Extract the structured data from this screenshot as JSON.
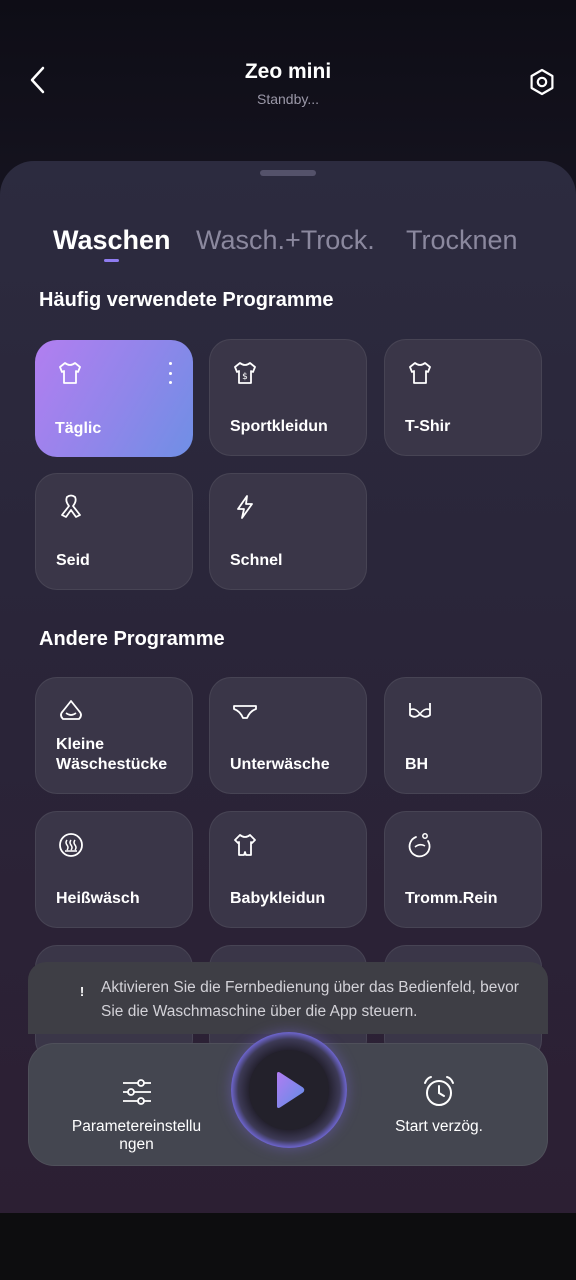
{
  "header": {
    "title": "Zeo mini",
    "subtitle": "Standby...",
    "back_icon": "chevron-left-icon",
    "settings_icon": "gear-icon"
  },
  "tabs": [
    {
      "label": "Waschen",
      "active": true
    },
    {
      "label": "Wasch.+Trock.",
      "active": false
    },
    {
      "label": "Trocknen",
      "active": false
    }
  ],
  "frequent": {
    "title": "Häufig verwendete Programme",
    "items": [
      {
        "label": "Täglic",
        "icon": "shirt-icon",
        "selected": true
      },
      {
        "label": "Sportkleidun",
        "icon": "sport-shirt-icon"
      },
      {
        "label": "T-Shir",
        "icon": "tshirt-icon"
      },
      {
        "label": "Seid",
        "icon": "ribbon-icon"
      },
      {
        "label": "Schnel",
        "icon": "lightning-icon"
      }
    ]
  },
  "other": {
    "title": "Andere Programme",
    "items": [
      {
        "label": "Kleine Wäschestücke",
        "icon": "small-items-icon"
      },
      {
        "label": "Unterwäsche",
        "icon": "underwear-icon"
      },
      {
        "label": "BH",
        "icon": "bra-icon"
      },
      {
        "label": "Heißwäsch",
        "icon": "hot-wash-icon"
      },
      {
        "label": "Babykleidun",
        "icon": "baby-clothes-icon"
      },
      {
        "label": "Tromm.Rein",
        "icon": "drum-clean-icon"
      }
    ]
  },
  "notice": {
    "icon": "!",
    "text": "Aktivieren Sie die Fernbedienung über das Bedienfeld, bevor Sie die Waschmaschine über die App steuern."
  },
  "bottom_bar": {
    "params_label": "Parametereinstellu ngen",
    "delay_label": "Start verzög.",
    "params_icon": "sliders-icon",
    "delay_icon": "alarm-clock-icon",
    "play_icon": "play-icon"
  },
  "colors": {
    "accent": "#8f7cf0",
    "selected_card_start": "#b27ef0",
    "selected_card_end": "#6f8fe5",
    "card_bg": "#3a3648"
  }
}
